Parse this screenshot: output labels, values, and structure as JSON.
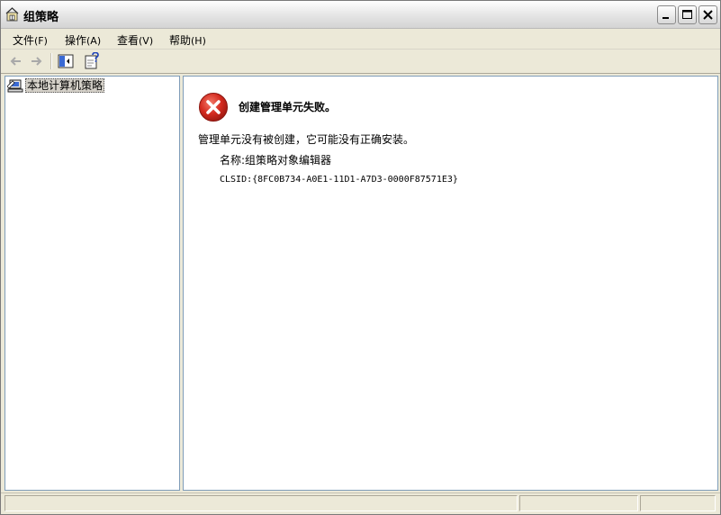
{
  "window": {
    "title": "组策略"
  },
  "menu": [
    {
      "label": "文件",
      "mnemonic": "(F)"
    },
    {
      "label": "操作",
      "mnemonic": "(A)"
    },
    {
      "label": "查看",
      "mnemonic": "(V)"
    },
    {
      "label": "帮助",
      "mnemonic": "(H)"
    }
  ],
  "toolbar": {
    "icons": [
      "back-arrow-icon",
      "forward-arrow-icon",
      "show-hide-tree-icon",
      "properties-help-icon"
    ]
  },
  "tree": {
    "root_label": "本地计算机策略"
  },
  "error": {
    "title": "创建管理单元失败。",
    "message": "管理单元没有被创建，它可能没有正确安装。",
    "name_line": "名称:组策略对象编辑器",
    "clsid_line": "CLSID:{8FC0B734-A0E1-11D1-A7D3-0000F87571E3}"
  },
  "colors": {
    "error_red": "#d42a1f",
    "pane_border": "#7f9db9",
    "chrome": "#ece9d8"
  }
}
